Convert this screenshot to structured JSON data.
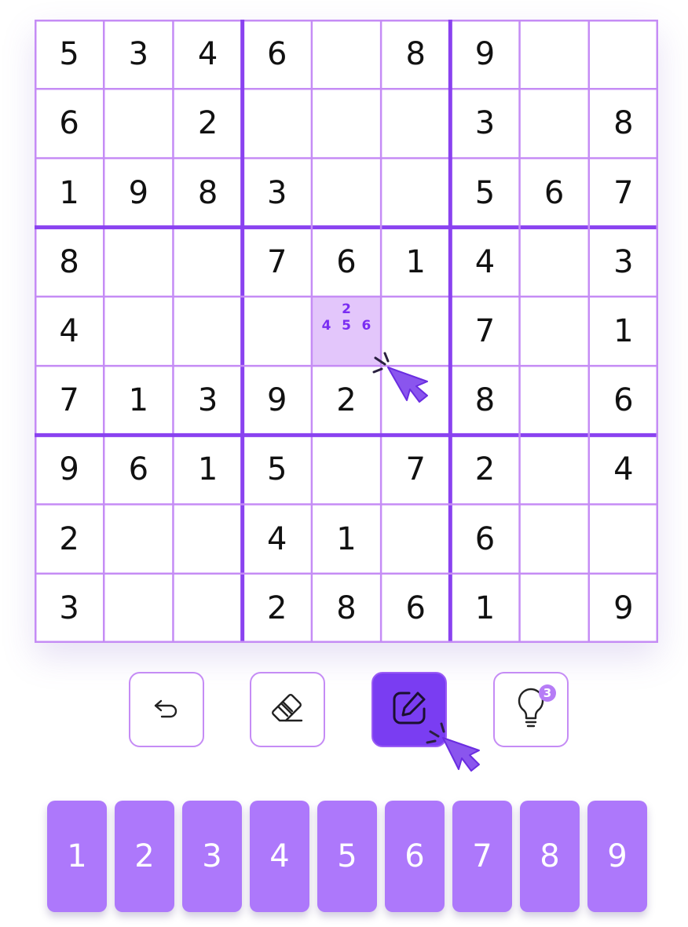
{
  "colors": {
    "thin_line": "#c58cf5",
    "thick_line": "#8a42f0",
    "selected_cell": "#e3c6fb",
    "note_text": "#7a2df2",
    "active_tool": "#7a3df2",
    "number_pad": "#ad78fb"
  },
  "grid": [
    [
      "5",
      "3",
      "4",
      "6",
      "",
      "8",
      "9",
      "",
      ""
    ],
    [
      "6",
      "",
      "2",
      "",
      "",
      "",
      "3",
      "",
      "8"
    ],
    [
      "1",
      "9",
      "8",
      "3",
      "",
      "",
      "5",
      "6",
      "7"
    ],
    [
      "8",
      "",
      "",
      "7",
      "6",
      "1",
      "4",
      "",
      "3"
    ],
    [
      "4",
      "",
      "",
      "",
      "",
      "",
      "7",
      "",
      "1"
    ],
    [
      "7",
      "1",
      "3",
      "9",
      "2",
      "",
      "8",
      "",
      "6"
    ],
    [
      "9",
      "6",
      "1",
      "5",
      "",
      "7",
      "2",
      "",
      "4"
    ],
    [
      "2",
      "",
      "",
      "4",
      "1",
      "",
      "6",
      "",
      ""
    ],
    [
      "3",
      "",
      "",
      "2",
      "8",
      "6",
      "1",
      "",
      "9"
    ]
  ],
  "selected_cell": {
    "row": 5,
    "col": 5,
    "notes": [
      "",
      "2",
      "",
      "4",
      "5",
      "6",
      "",
      "",
      ""
    ]
  },
  "toolbar": {
    "undo_icon": "undo-icon",
    "erase_icon": "eraser-icon",
    "notes_icon": "pencil-edit-icon",
    "notes_active": true,
    "hint_icon": "lightbulb-icon",
    "hint_count": "3"
  },
  "number_pad": [
    "1",
    "2",
    "3",
    "4",
    "5",
    "6",
    "7",
    "8",
    "9"
  ]
}
